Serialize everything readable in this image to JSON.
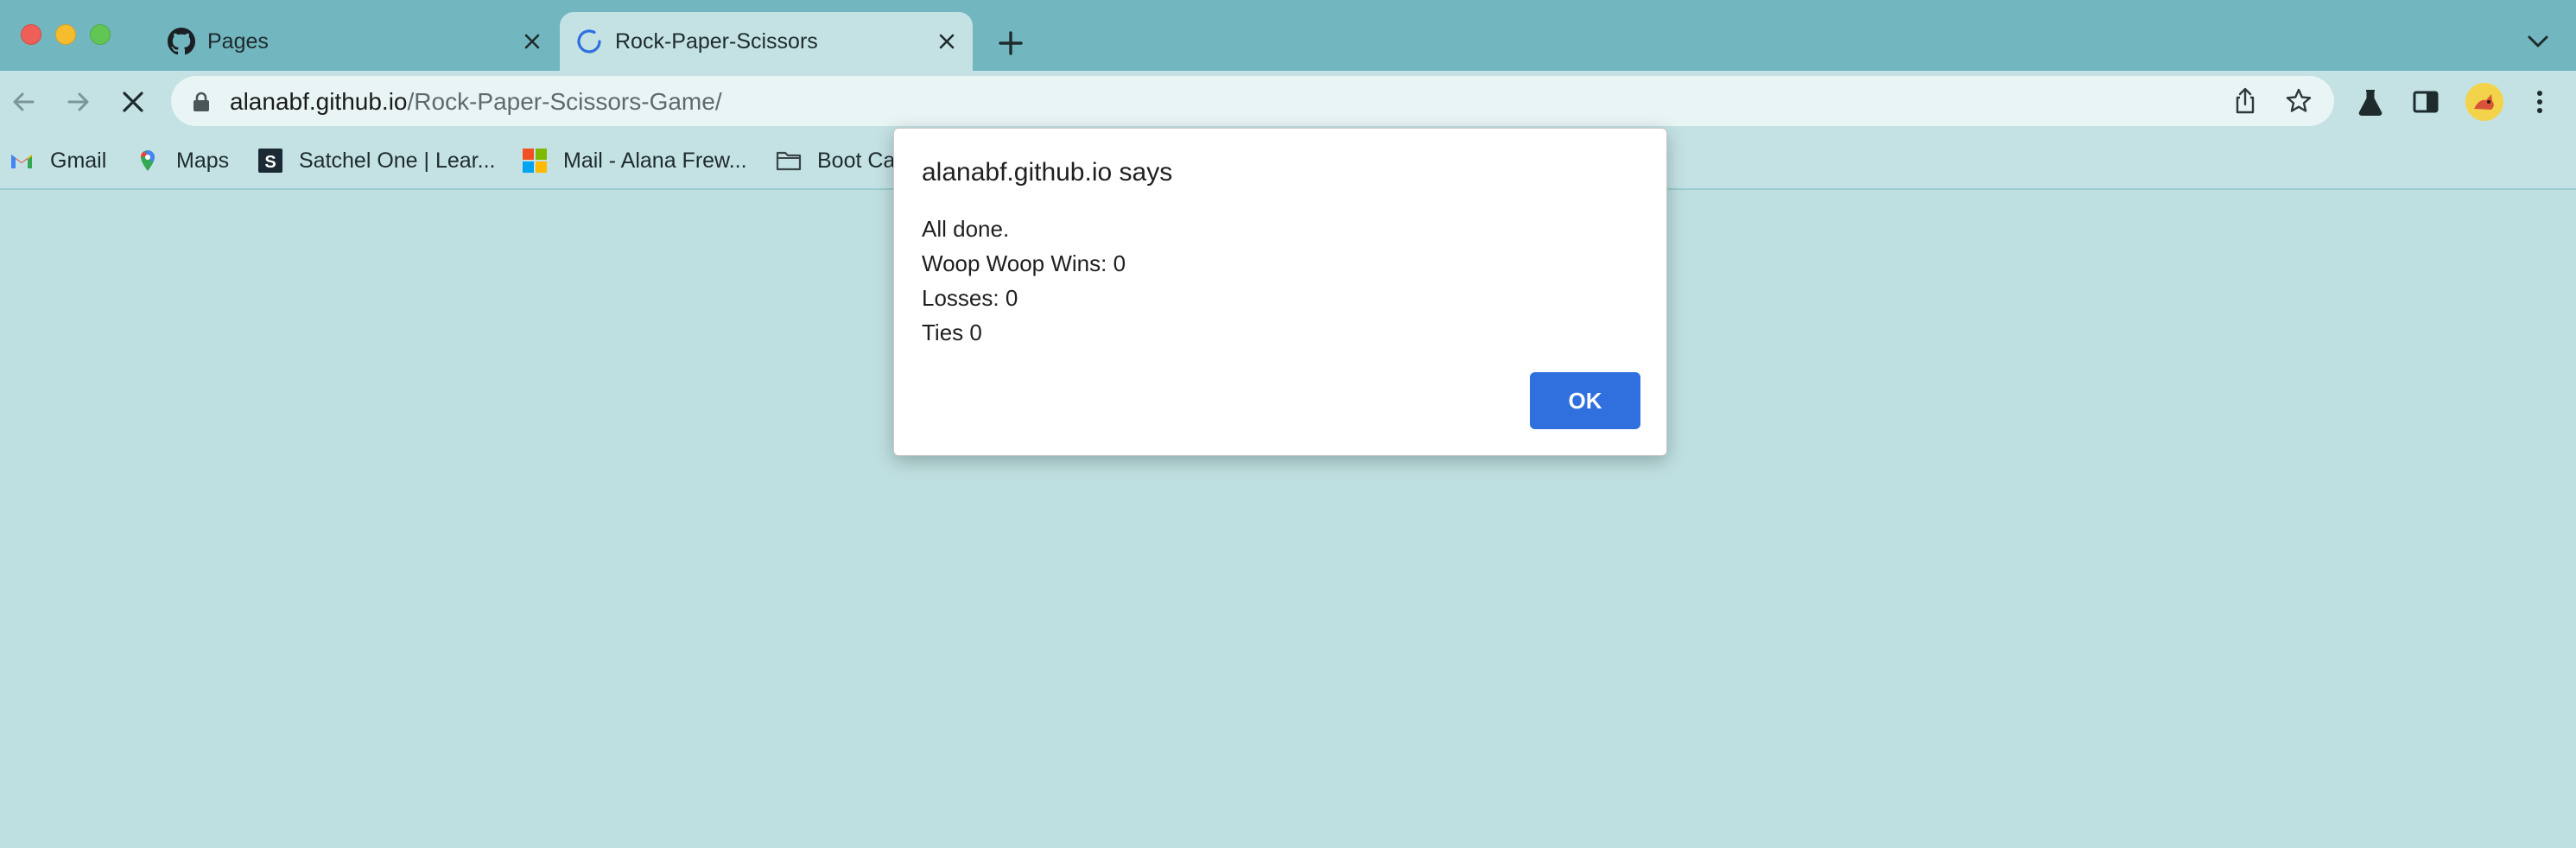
{
  "browser": {
    "tabs": [
      {
        "title": "Pages",
        "favicon": "github-icon",
        "active": false
      },
      {
        "title": "Rock-Paper-Scissors",
        "favicon": "loading-spinner-icon",
        "active": true
      }
    ],
    "url": {
      "host": "alanabf.github.io",
      "path": "/Rock-Paper-Scissors-Game/"
    },
    "bookmarks": [
      {
        "label": "Gmail",
        "icon": "gmail-icon"
      },
      {
        "label": "Maps",
        "icon": "maps-icon"
      },
      {
        "label": "Satchel One | Lear...",
        "icon": "satchel-one-icon"
      },
      {
        "label": "Mail - Alana Frew...",
        "icon": "microsoft-icon"
      },
      {
        "label": "Boot Ca",
        "icon": "folder-icon"
      }
    ],
    "colors": {
      "tabstrip": "#72b6bf",
      "toolbar": "#c4e2e4",
      "page_background": "#bfe0e1",
      "accent": "#2f6fde"
    }
  },
  "dialog": {
    "title": "alanabf.github.io says",
    "lines": [
      "All done.",
      "Woop Woop Wins: 0",
      "Losses: 0",
      "Ties 0"
    ],
    "ok_label": "OK"
  }
}
